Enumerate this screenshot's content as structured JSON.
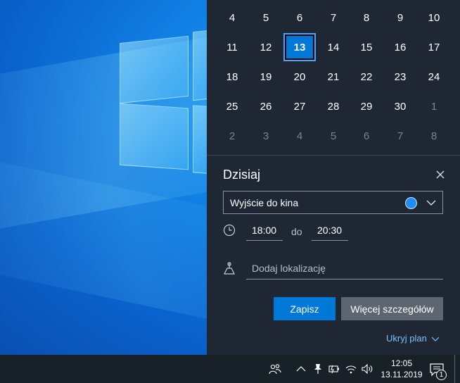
{
  "calendar": {
    "rows": [
      [
        {
          "d": "4"
        },
        {
          "d": "5"
        },
        {
          "d": "6"
        },
        {
          "d": "7"
        },
        {
          "d": "8"
        },
        {
          "d": "9"
        },
        {
          "d": "10"
        }
      ],
      [
        {
          "d": "11"
        },
        {
          "d": "12"
        },
        {
          "d": "13",
          "today": true
        },
        {
          "d": "14"
        },
        {
          "d": "15"
        },
        {
          "d": "16"
        },
        {
          "d": "17"
        }
      ],
      [
        {
          "d": "18"
        },
        {
          "d": "19"
        },
        {
          "d": "20"
        },
        {
          "d": "21"
        },
        {
          "d": "22"
        },
        {
          "d": "23"
        },
        {
          "d": "24"
        }
      ],
      [
        {
          "d": "25"
        },
        {
          "d": "26"
        },
        {
          "d": "27"
        },
        {
          "d": "28"
        },
        {
          "d": "29"
        },
        {
          "d": "30"
        },
        {
          "d": "1",
          "dim": true
        }
      ],
      [
        {
          "d": "2",
          "dim": true
        },
        {
          "d": "3",
          "dim": true
        },
        {
          "d": "4",
          "dim": true
        },
        {
          "d": "5",
          "dim": true
        },
        {
          "d": "6",
          "dim": true
        },
        {
          "d": "7",
          "dim": true
        },
        {
          "d": "8",
          "dim": true
        }
      ]
    ]
  },
  "agenda": {
    "title": "Dzisiaj",
    "event_name": "Wyjście do kina",
    "event_color": "#1f8ef0",
    "start_time": "18:00",
    "time_separator": "do",
    "end_time": "20:30",
    "location_placeholder": "Dodaj lokalizację",
    "save_label": "Zapisz",
    "more_details_label": "Więcej szczegółów",
    "hide_plan_label": "Ukryj plan"
  },
  "taskbar": {
    "time": "12:05",
    "date": "13.11.2019",
    "notification_count": "1"
  },
  "colors": {
    "accent": "#0078d7",
    "panel_bg": "#1e2733",
    "taskbar_bg": "#182028"
  }
}
